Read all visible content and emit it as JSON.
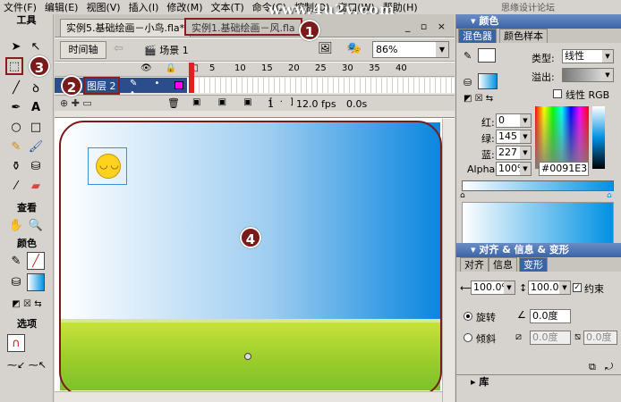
{
  "menu": [
    "文件(F)",
    "编辑(E)",
    "视图(V)",
    "插入(I)",
    "修改(M)",
    "文本(T)",
    "命令(C)",
    "控制(O)",
    "窗口(W)",
    "帮助(H)"
  ],
  "watermark": "www.4u2v.com",
  "watermark_right": "思缘设计论坛",
  "toolbox": {
    "title": "工具",
    "view_label": "查看",
    "color_label": "颜色",
    "options_label": "选项"
  },
  "document": {
    "tabs": [
      "实例5.基础绘画－小鸟.fla*",
      "实例1.基础绘画－风.fla"
    ],
    "window_controls": "_ ▫ ×",
    "timeline_button": "时间轴",
    "scene": "场景 1",
    "zoom": "86%"
  },
  "timeline": {
    "ticks": [
      "1",
      "5",
      "10",
      "15",
      "20",
      "25",
      "30",
      "35",
      "40"
    ],
    "layer_name": "图层 2",
    "frame": "1",
    "fps": "12.0 fps",
    "time": "0.0s"
  },
  "markers": [
    "1",
    "2",
    "3",
    "4"
  ],
  "color_panel": {
    "title": "颜色",
    "tabs": [
      "混色器",
      "颜色样本"
    ],
    "type_label": "类型:",
    "type_value": "线性",
    "overflow_label": "溢出:",
    "linear_rgb_label": "线性 RGB",
    "red_label": "红:",
    "red": "0",
    "green_label": "绿:",
    "green": "145",
    "blue_label": "蓝:",
    "blue": "227",
    "alpha_label": "Alpha:",
    "alpha": "100%",
    "hex": "#0091E3"
  },
  "transform_panel": {
    "title": "对齐 & 信息 & 变形",
    "tabs": [
      "对齐",
      "信息",
      "变形"
    ],
    "width": "100.0%",
    "height": "100.0%",
    "constrain_label": "约束",
    "rotate_label": "旋转",
    "rotate_value": "0.0度",
    "skew_label": "倾斜",
    "skew_h": "0.0度",
    "skew_v": "0.0度"
  },
  "library_title": "库",
  "colors": {
    "accent": "#0091E3",
    "marker": "#7a1b1b",
    "panel_title": "#3a64a8"
  }
}
